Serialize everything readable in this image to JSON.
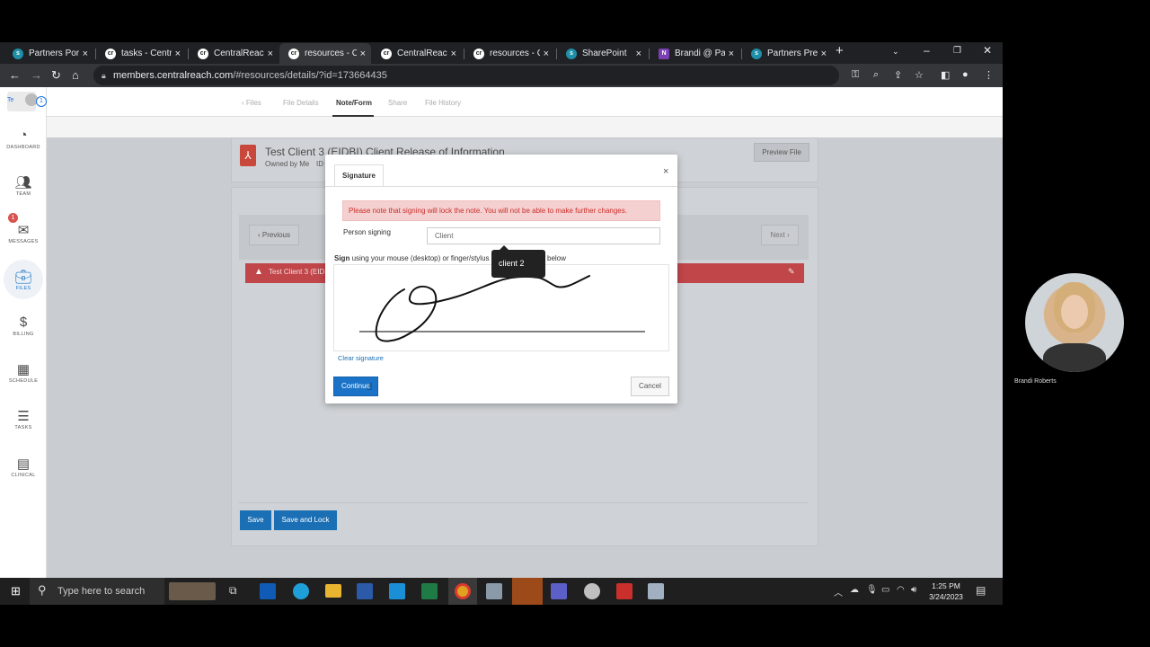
{
  "browser": {
    "tabs": [
      {
        "title": "Partners Portal",
        "color": "#1e8fa8"
      },
      {
        "title": "tasks - Central",
        "color": "#ffffff"
      },
      {
        "title": "CentralReach",
        "color": "#ffffff"
      },
      {
        "title": "resources - Ce",
        "color": "#ffffff"
      },
      {
        "title": "CentralReach",
        "color": "#ffffff"
      },
      {
        "title": "resources - Ce",
        "color": "#ffffff"
      },
      {
        "title": "SharePoint",
        "color": "#1e8fa8"
      },
      {
        "title": "Brandi @ Part",
        "color": "#7b3fb3"
      },
      {
        "title": "Partners Press",
        "color": "#1e8fa8"
      }
    ],
    "url_domain": "members.centralreach.com",
    "url_path": "/#resources/details/?id=173664435"
  },
  "sidebar": {
    "user_initials": "Te",
    "notif_count": "1",
    "messages_badge": "1",
    "items": [
      {
        "label": "DASHBOARD",
        "icon": "gauge-icon"
      },
      {
        "label": "TEAM",
        "icon": "team-icon"
      },
      {
        "label": "MESSAGES",
        "icon": "envelope-icon"
      },
      {
        "label": "FILES",
        "icon": "briefcase-icon"
      },
      {
        "label": "BILLING",
        "icon": "dollar-icon"
      },
      {
        "label": "SCHEDULE",
        "icon": "calendar-icon"
      },
      {
        "label": "TASKS",
        "icon": "tasks-icon"
      },
      {
        "label": "CLINICAL",
        "icon": "book-icon"
      }
    ]
  },
  "topnav": {
    "files": "Files",
    "file_details": "File Details",
    "note_form": "Note/Form",
    "share": "Share",
    "file_history": "File History"
  },
  "file": {
    "title": "Test Client 3 (EIDBI) Client Release of Information",
    "owner": "Owned by Me",
    "id_label": "ID",
    "preview": "Preview File"
  },
  "pager": {
    "previous": "Previous",
    "next": "Next"
  },
  "banner": {
    "text": "Test Client 3 (EID"
  },
  "actions": {
    "save": "Save",
    "save_lock": "Save and Lock"
  },
  "modal": {
    "tab": "Signature",
    "warning": "Please note that signing will lock the note. You will not be able to make further changes.",
    "person_label": "Person signing",
    "person_value": "Client",
    "instr_bold": "Sign",
    "instr_rest": " using your mouse (desktop) or finger/stylus (",
    "instr_end": "below",
    "tooltip": "client 2",
    "clear": "Clear signature",
    "continue": "Continue",
    "cancel": "Cancel"
  },
  "participant": {
    "name": "Brandi Roberts"
  },
  "taskbar": {
    "search_placeholder": "Type here to search",
    "time": "1:25 PM",
    "date": "3/24/2023"
  }
}
